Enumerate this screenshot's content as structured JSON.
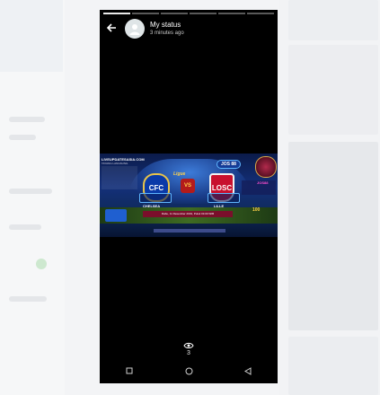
{
  "status_header": {
    "title": "My status",
    "time": "3 minutes ago"
  },
  "progress": {
    "segments": 6,
    "active_index": 0
  },
  "poster": {
    "brand": "LIVEUPDATESASIA.COM",
    "brand_sub": "TAYANG LANGSUNG",
    "jos_badge": "JOS 88",
    "liga": "Ligue",
    "home_crest": "CFC",
    "vs": "VS",
    "away_crest": "LOSC",
    "home_team": "CHELSEA",
    "away_team": "LILLE",
    "date_bar": "Rabu, 11 Desember 2019, Pukul 03.00 WIB",
    "neon": "JOS88",
    "odds": "100"
  },
  "footer": {
    "view_count": "3"
  },
  "colors": {
    "accent": "#e7c34a",
    "viewer_bg": "#000000"
  },
  "icons": {
    "back": "back-arrow-icon",
    "eye": "eye-icon",
    "nav_recent": "recent-apps-icon",
    "nav_home": "home-icon",
    "nav_back": "nav-back-icon"
  }
}
